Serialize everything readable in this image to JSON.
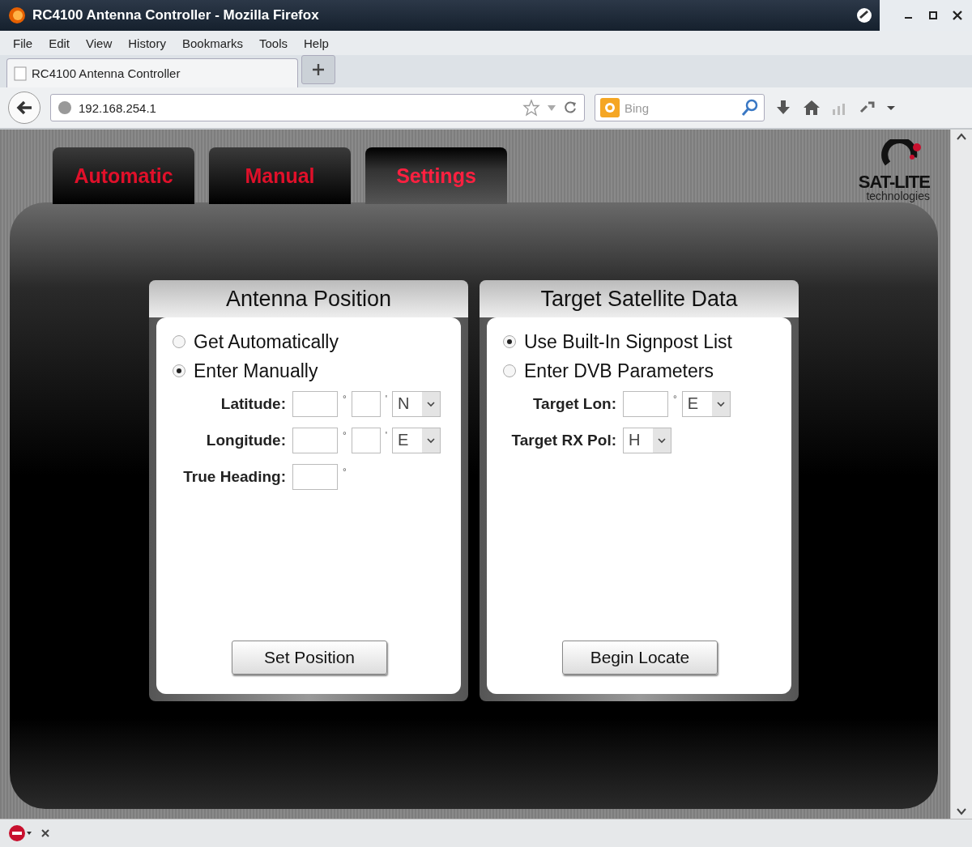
{
  "window": {
    "title": "RC4100 Antenna Controller - Mozilla Firefox"
  },
  "menu": [
    "File",
    "Edit",
    "View",
    "History",
    "Bookmarks",
    "Tools",
    "Help"
  ],
  "browser_tab": {
    "title": "RC4100 Antenna Controller"
  },
  "address_bar": {
    "value": "192.168.254.1"
  },
  "search": {
    "placeholder": "Bing"
  },
  "app_tabs": [
    {
      "label": "Automatic",
      "selected": false
    },
    {
      "label": "Manual",
      "selected": false
    },
    {
      "label": "Settings",
      "selected": true
    }
  ],
  "logo": {
    "name": "SAT-LITE",
    "tagline": "technologies"
  },
  "panels": [
    {
      "title": "Antenna Position",
      "options": [
        {
          "label": "Get Automatically",
          "selected": false
        },
        {
          "label": "Enter Manually",
          "selected": true
        }
      ],
      "fields": [
        {
          "label": "Latitude:",
          "parts": [
            {
              "kind": "input"
            },
            {
              "kind": "unit",
              "text": "°"
            },
            {
              "kind": "input"
            },
            {
              "kind": "unit",
              "text": "'"
            },
            {
              "kind": "select",
              "value": "N"
            }
          ]
        },
        {
          "label": "Longitude:",
          "parts": [
            {
              "kind": "input"
            },
            {
              "kind": "unit",
              "text": "°"
            },
            {
              "kind": "input"
            },
            {
              "kind": "unit",
              "text": "'"
            },
            {
              "kind": "select",
              "value": "E"
            }
          ]
        },
        {
          "label": "True Heading:",
          "parts": [
            {
              "kind": "input"
            },
            {
              "kind": "unit",
              "text": "°"
            }
          ]
        }
      ],
      "button": "Set Position"
    },
    {
      "title": "Target Satellite Data",
      "options": [
        {
          "label": "Use Built-In Signpost List",
          "selected": true
        },
        {
          "label": "Enter DVB Parameters",
          "selected": false
        }
      ],
      "fields": [
        {
          "label": "Target Lon:",
          "parts": [
            {
              "kind": "input"
            },
            {
              "kind": "unit",
              "text": "°"
            },
            {
              "kind": "select",
              "value": "E"
            }
          ]
        },
        {
          "label": "Target RX Pol:",
          "parts": [
            {
              "kind": "select",
              "value": "H"
            }
          ]
        }
      ],
      "button": "Begin Locate"
    }
  ]
}
